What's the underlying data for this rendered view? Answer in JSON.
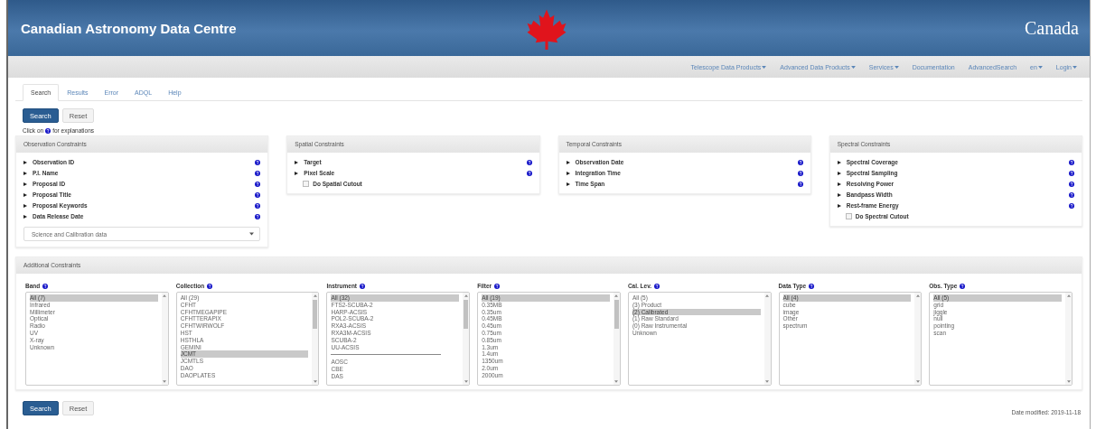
{
  "header": {
    "title": "Canadian Astronomy Data Centre",
    "wordmark": "Canada"
  },
  "nav": [
    {
      "label": "Telescope Data Products",
      "dropdown": true
    },
    {
      "label": "Advanced Data Products",
      "dropdown": true
    },
    {
      "label": "Services",
      "dropdown": true
    },
    {
      "label": "Documentation",
      "dropdown": false
    },
    {
      "label": "AdvancedSearch",
      "dropdown": false
    },
    {
      "label": "en",
      "dropdown": true
    },
    {
      "label": "Login",
      "dropdown": true
    }
  ],
  "tabs": [
    {
      "label": "Search",
      "selected": true
    },
    {
      "label": "Results",
      "selected": false
    },
    {
      "label": "Error",
      "selected": false
    },
    {
      "label": "ADQL",
      "selected": false
    },
    {
      "label": "Help",
      "selected": false
    }
  ],
  "top_buttons": [
    {
      "label": "Search",
      "kind": "primary"
    },
    {
      "label": "Reset",
      "kind": "default"
    }
  ],
  "hint": {
    "before": "Click on",
    "after": "for explanations"
  },
  "panels": [
    {
      "title": "Observation Constraints",
      "fields": [
        {
          "kind": "toggle",
          "label": "Observation ID",
          "help": true
        },
        {
          "kind": "toggle",
          "label": "P.I. Name",
          "help": true
        },
        {
          "kind": "toggle",
          "label": "Proposal ID",
          "help": true
        },
        {
          "kind": "toggle",
          "label": "Proposal Title",
          "help": true
        },
        {
          "kind": "toggle",
          "label": "Proposal Keywords",
          "help": true
        },
        {
          "kind": "toggle",
          "label": "Data Release Date",
          "help": true
        }
      ],
      "select": "Science and Calibration data"
    },
    {
      "title": "Spatial Constraints",
      "fields": [
        {
          "kind": "toggle",
          "label": "Target",
          "help": true
        },
        {
          "kind": "toggle",
          "label": "Pixel Scale",
          "help": true
        },
        {
          "kind": "checkbox",
          "label": "Do Spatial Cutout",
          "checked": false
        }
      ]
    },
    {
      "title": "Temporal Constraints",
      "fields": [
        {
          "kind": "toggle",
          "label": "Observation Date",
          "help": true
        },
        {
          "kind": "toggle",
          "label": "Integration Time",
          "help": true
        },
        {
          "kind": "toggle",
          "label": "Time Span",
          "help": true
        }
      ]
    },
    {
      "title": "Spectral Constraints",
      "fields": [
        {
          "kind": "toggle",
          "label": "Spectral Coverage",
          "help": true
        },
        {
          "kind": "toggle",
          "label": "Spectral Sampling",
          "help": true
        },
        {
          "kind": "toggle",
          "label": "Resolving Power",
          "help": true
        },
        {
          "kind": "toggle",
          "label": "Bandpass Width",
          "help": true
        },
        {
          "kind": "toggle",
          "label": "Rest-frame Energy",
          "help": true
        },
        {
          "kind": "checkbox",
          "label": "Do Spectral Cutout",
          "checked": false
        }
      ]
    }
  ],
  "additional": {
    "title": "Additional Constraints",
    "lists": [
      {
        "label": "Band",
        "overflow": false,
        "items": [
          {
            "kind": "option",
            "label": "All (7)",
            "selected": true
          },
          {
            "kind": "option",
            "label": "Infrared",
            "selected": false
          },
          {
            "kind": "option",
            "label": "Millimeter",
            "selected": false
          },
          {
            "kind": "option",
            "label": "Optical",
            "selected": false
          },
          {
            "kind": "option",
            "label": "Radio",
            "selected": false
          },
          {
            "kind": "option",
            "label": "UV",
            "selected": false
          },
          {
            "kind": "option",
            "label": "X-ray",
            "selected": false
          },
          {
            "kind": "option",
            "label": "Unknown",
            "selected": false
          }
        ]
      },
      {
        "label": "Collection",
        "overflow": true,
        "items": [
          {
            "kind": "option",
            "label": "All (29)",
            "selected": false
          },
          {
            "kind": "option",
            "label": "CFHT",
            "selected": false
          },
          {
            "kind": "option",
            "label": "CFHTMEGAPIPE",
            "selected": false
          },
          {
            "kind": "option",
            "label": "CFHTTERAPIX",
            "selected": false
          },
          {
            "kind": "option",
            "label": "CFHTWIRWOLF",
            "selected": false
          },
          {
            "kind": "option",
            "label": "HST",
            "selected": false
          },
          {
            "kind": "option",
            "label": "HSTHLA",
            "selected": false
          },
          {
            "kind": "option",
            "label": "GEMINI",
            "selected": false
          },
          {
            "kind": "option",
            "label": "JCMT",
            "selected": true
          },
          {
            "kind": "option",
            "label": "JCMTLS",
            "selected": false
          },
          {
            "kind": "option",
            "label": "DAO",
            "selected": false
          },
          {
            "kind": "option",
            "label": "DAOPLATES",
            "selected": false
          }
        ]
      },
      {
        "label": "Instrument",
        "overflow": true,
        "items": [
          {
            "kind": "option",
            "label": "All (32)",
            "selected": true
          },
          {
            "kind": "option",
            "label": "FTS2-SCUBA-2",
            "selected": false
          },
          {
            "kind": "option",
            "label": "HARP-ACSIS",
            "selected": false
          },
          {
            "kind": "option",
            "label": "POL2-SCUBA-2",
            "selected": false
          },
          {
            "kind": "option",
            "label": "RXA3-ACSIS",
            "selected": false
          },
          {
            "kind": "option",
            "label": "RXA3M-ACSIS",
            "selected": false
          },
          {
            "kind": "option",
            "label": "SCUBA-2",
            "selected": false
          },
          {
            "kind": "option",
            "label": "UU-ACSIS",
            "selected": false
          },
          {
            "kind": "separator"
          },
          {
            "kind": "option",
            "label": "AOSC",
            "selected": false
          },
          {
            "kind": "option",
            "label": "CBE",
            "selected": false
          },
          {
            "kind": "option",
            "label": "DAS",
            "selected": false
          }
        ]
      },
      {
        "label": "Filter",
        "overflow": true,
        "items": [
          {
            "kind": "option",
            "label": "All (19)",
            "selected": true
          },
          {
            "kind": "option",
            "label": "0.35MB",
            "selected": false
          },
          {
            "kind": "option",
            "label": "0.35um",
            "selected": false
          },
          {
            "kind": "option",
            "label": "0.45MB",
            "selected": false
          },
          {
            "kind": "option",
            "label": "0.45um",
            "selected": false
          },
          {
            "kind": "option",
            "label": "0.75um",
            "selected": false
          },
          {
            "kind": "option",
            "label": "0.85um",
            "selected": false
          },
          {
            "kind": "option",
            "label": "1.3um",
            "selected": false
          },
          {
            "kind": "option",
            "label": "1.4um",
            "selected": false
          },
          {
            "kind": "option",
            "label": "1350um",
            "selected": false
          },
          {
            "kind": "option",
            "label": "2.0um",
            "selected": false
          },
          {
            "kind": "option",
            "label": "2000um",
            "selected": false
          }
        ]
      },
      {
        "label": "Cal. Lev.",
        "overflow": false,
        "items": [
          {
            "kind": "option",
            "label": "All (5)",
            "selected": false
          },
          {
            "kind": "option",
            "label": "(3) Product",
            "selected": false
          },
          {
            "kind": "option",
            "label": "(2) Calibrated",
            "selected": true
          },
          {
            "kind": "option",
            "label": "(1) Raw Standard",
            "selected": false
          },
          {
            "kind": "option",
            "label": "(0) Raw Instrumental",
            "selected": false
          },
          {
            "kind": "option",
            "label": "Unknown",
            "selected": false
          }
        ]
      },
      {
        "label": "Data Type",
        "overflow": false,
        "items": [
          {
            "kind": "option",
            "label": "All (4)",
            "selected": true
          },
          {
            "kind": "option",
            "label": "cube",
            "selected": false
          },
          {
            "kind": "option",
            "label": "image",
            "selected": false
          },
          {
            "kind": "option",
            "label": "Other",
            "selected": false
          },
          {
            "kind": "option",
            "label": "spectrum",
            "selected": false
          }
        ]
      },
      {
        "label": "Obs. Type",
        "overflow": false,
        "items": [
          {
            "kind": "option",
            "label": "All (5)",
            "selected": true
          },
          {
            "kind": "option",
            "label": "grid",
            "selected": false
          },
          {
            "kind": "option",
            "label": "jiggle",
            "selected": false
          },
          {
            "kind": "option",
            "label": "null",
            "selected": false
          },
          {
            "kind": "option",
            "label": "pointing",
            "selected": false
          },
          {
            "kind": "option",
            "label": "scan",
            "selected": false
          }
        ]
      }
    ]
  },
  "bottom_buttons": [
    {
      "label": "Search",
      "kind": "primary"
    },
    {
      "label": "Reset",
      "kind": "default"
    }
  ],
  "date_modified": "Date modified: 2019-11-18"
}
